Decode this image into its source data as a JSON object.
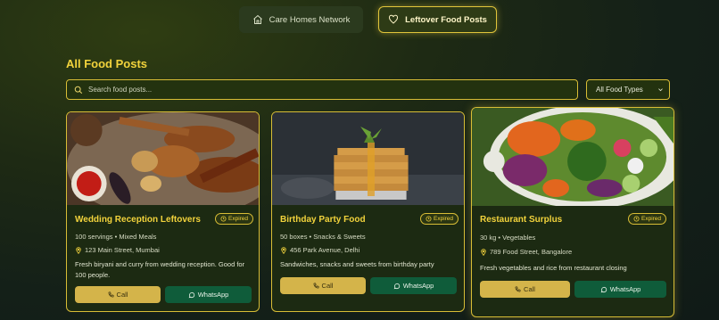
{
  "nav": {
    "care_homes": {
      "label": "Care Homes Network",
      "icon": "home-icon"
    },
    "leftover_food": {
      "label": "Leftover Food Posts",
      "icon": "heart-icon",
      "active": true
    }
  },
  "section": {
    "title": "All Food Posts"
  },
  "search": {
    "placeholder": "Search food posts...",
    "value": ""
  },
  "filter": {
    "selected": "All Food Types"
  },
  "colors": {
    "accent": "#f2d33c",
    "border": "#d8bd36",
    "call_button": "#d4b44a",
    "whatsapp_button": "#0f5c3a",
    "background": "#1c2a12"
  },
  "posts": [
    {
      "title": "Wedding Reception Leftovers",
      "status": "Expired",
      "meta": "100 servings • Mixed Meals",
      "address": "123 Main Street, Mumbai",
      "description": "Fresh biryani and curry from wedding reception. Good for 100 people.",
      "call_label": "Call",
      "whatsapp_label": "WhatsApp"
    },
    {
      "title": "Birthday Party Food",
      "status": "Expired",
      "meta": "50 boxes • Snacks & Sweets",
      "address": "456 Park Avenue, Delhi",
      "description": "Sandwiches, snacks and sweets from birthday party",
      "call_label": "Call",
      "whatsapp_label": "WhatsApp"
    },
    {
      "title": "Restaurant Surplus",
      "status": "Expired",
      "meta": "30 kg • Vegetables",
      "address": "789 Food Street, Bangalore",
      "description": "Fresh vegetables and rice from restaurant closing",
      "call_label": "Call",
      "whatsapp_label": "WhatsApp"
    }
  ]
}
